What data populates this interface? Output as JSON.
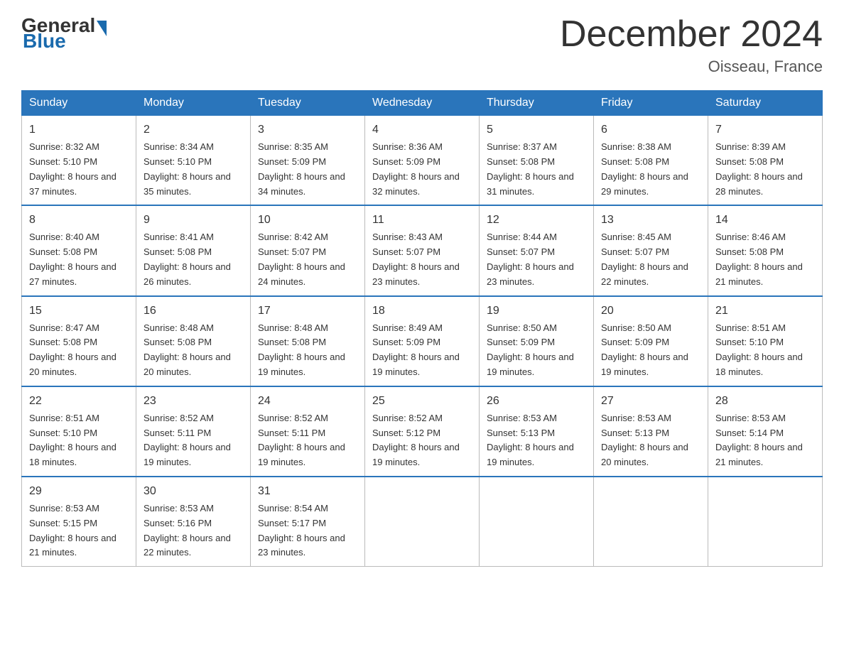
{
  "header": {
    "logo_general": "General",
    "logo_blue": "Blue",
    "title": "December 2024",
    "location": "Oisseau, France"
  },
  "days_of_week": [
    "Sunday",
    "Monday",
    "Tuesday",
    "Wednesday",
    "Thursday",
    "Friday",
    "Saturday"
  ],
  "weeks": [
    [
      {
        "day": "1",
        "sunrise": "8:32 AM",
        "sunset": "5:10 PM",
        "daylight": "8 hours and 37 minutes."
      },
      {
        "day": "2",
        "sunrise": "8:34 AM",
        "sunset": "5:10 PM",
        "daylight": "8 hours and 35 minutes."
      },
      {
        "day": "3",
        "sunrise": "8:35 AM",
        "sunset": "5:09 PM",
        "daylight": "8 hours and 34 minutes."
      },
      {
        "day": "4",
        "sunrise": "8:36 AM",
        "sunset": "5:09 PM",
        "daylight": "8 hours and 32 minutes."
      },
      {
        "day": "5",
        "sunrise": "8:37 AM",
        "sunset": "5:08 PM",
        "daylight": "8 hours and 31 minutes."
      },
      {
        "day": "6",
        "sunrise": "8:38 AM",
        "sunset": "5:08 PM",
        "daylight": "8 hours and 29 minutes."
      },
      {
        "day": "7",
        "sunrise": "8:39 AM",
        "sunset": "5:08 PM",
        "daylight": "8 hours and 28 minutes."
      }
    ],
    [
      {
        "day": "8",
        "sunrise": "8:40 AM",
        "sunset": "5:08 PM",
        "daylight": "8 hours and 27 minutes."
      },
      {
        "day": "9",
        "sunrise": "8:41 AM",
        "sunset": "5:08 PM",
        "daylight": "8 hours and 26 minutes."
      },
      {
        "day": "10",
        "sunrise": "8:42 AM",
        "sunset": "5:07 PM",
        "daylight": "8 hours and 24 minutes."
      },
      {
        "day": "11",
        "sunrise": "8:43 AM",
        "sunset": "5:07 PM",
        "daylight": "8 hours and 23 minutes."
      },
      {
        "day": "12",
        "sunrise": "8:44 AM",
        "sunset": "5:07 PM",
        "daylight": "8 hours and 23 minutes."
      },
      {
        "day": "13",
        "sunrise": "8:45 AM",
        "sunset": "5:07 PM",
        "daylight": "8 hours and 22 minutes."
      },
      {
        "day": "14",
        "sunrise": "8:46 AM",
        "sunset": "5:08 PM",
        "daylight": "8 hours and 21 minutes."
      }
    ],
    [
      {
        "day": "15",
        "sunrise": "8:47 AM",
        "sunset": "5:08 PM",
        "daylight": "8 hours and 20 minutes."
      },
      {
        "day": "16",
        "sunrise": "8:48 AM",
        "sunset": "5:08 PM",
        "daylight": "8 hours and 20 minutes."
      },
      {
        "day": "17",
        "sunrise": "8:48 AM",
        "sunset": "5:08 PM",
        "daylight": "8 hours and 19 minutes."
      },
      {
        "day": "18",
        "sunrise": "8:49 AM",
        "sunset": "5:09 PM",
        "daylight": "8 hours and 19 minutes."
      },
      {
        "day": "19",
        "sunrise": "8:50 AM",
        "sunset": "5:09 PM",
        "daylight": "8 hours and 19 minutes."
      },
      {
        "day": "20",
        "sunrise": "8:50 AM",
        "sunset": "5:09 PM",
        "daylight": "8 hours and 19 minutes."
      },
      {
        "day": "21",
        "sunrise": "8:51 AM",
        "sunset": "5:10 PM",
        "daylight": "8 hours and 18 minutes."
      }
    ],
    [
      {
        "day": "22",
        "sunrise": "8:51 AM",
        "sunset": "5:10 PM",
        "daylight": "8 hours and 18 minutes."
      },
      {
        "day": "23",
        "sunrise": "8:52 AM",
        "sunset": "5:11 PM",
        "daylight": "8 hours and 19 minutes."
      },
      {
        "day": "24",
        "sunrise": "8:52 AM",
        "sunset": "5:11 PM",
        "daylight": "8 hours and 19 minutes."
      },
      {
        "day": "25",
        "sunrise": "8:52 AM",
        "sunset": "5:12 PM",
        "daylight": "8 hours and 19 minutes."
      },
      {
        "day": "26",
        "sunrise": "8:53 AM",
        "sunset": "5:13 PM",
        "daylight": "8 hours and 19 minutes."
      },
      {
        "day": "27",
        "sunrise": "8:53 AM",
        "sunset": "5:13 PM",
        "daylight": "8 hours and 20 minutes."
      },
      {
        "day": "28",
        "sunrise": "8:53 AM",
        "sunset": "5:14 PM",
        "daylight": "8 hours and 21 minutes."
      }
    ],
    [
      {
        "day": "29",
        "sunrise": "8:53 AM",
        "sunset": "5:15 PM",
        "daylight": "8 hours and 21 minutes."
      },
      {
        "day": "30",
        "sunrise": "8:53 AM",
        "sunset": "5:16 PM",
        "daylight": "8 hours and 22 minutes."
      },
      {
        "day": "31",
        "sunrise": "8:54 AM",
        "sunset": "5:17 PM",
        "daylight": "8 hours and 23 minutes."
      },
      null,
      null,
      null,
      null
    ]
  ]
}
